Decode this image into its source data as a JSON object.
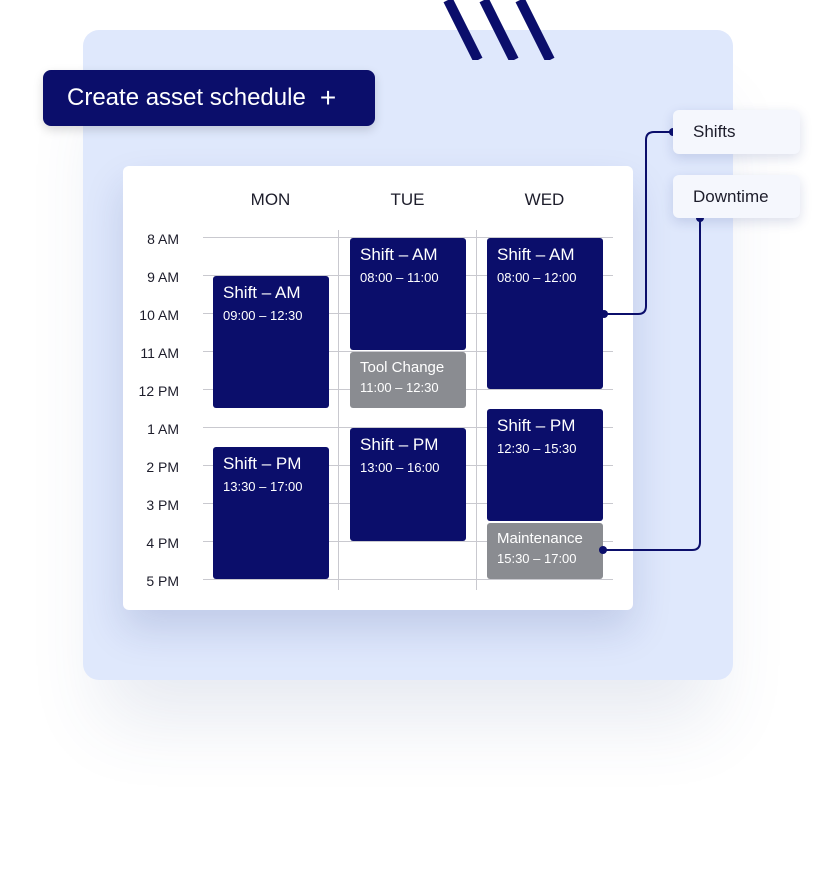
{
  "create_button": {
    "label": "Create asset schedule",
    "icon": "plus-icon"
  },
  "calendar": {
    "days": [
      "MON",
      "TUE",
      "WED"
    ],
    "times": [
      "8 AM",
      "9 AM",
      "10 AM",
      "11 AM",
      "12 PM",
      "1 AM",
      "2 PM",
      "3 PM",
      "4 PM",
      "5 PM"
    ],
    "events": {
      "mon_am": {
        "title": "Shift – AM",
        "range": "09:00 – 12:30",
        "type": "shift"
      },
      "mon_pm": {
        "title": "Shift – PM",
        "range": "13:30 – 17:00",
        "type": "shift"
      },
      "tue_am": {
        "title": "Shift – AM",
        "range": "08:00 – 11:00",
        "type": "shift"
      },
      "tue_tool": {
        "title": "Tool Change",
        "range": "11:00 – 12:30",
        "type": "downtime"
      },
      "tue_pm": {
        "title": "Shift – PM",
        "range": "13:00 – 16:00",
        "type": "shift"
      },
      "wed_am": {
        "title": "Shift – AM",
        "range": "08:00 – 12:00",
        "type": "shift"
      },
      "wed_pm": {
        "title": "Shift – PM",
        "range": "12:30 – 15:30",
        "type": "shift"
      },
      "wed_maint": {
        "title": "Maintenance",
        "range": "15:30 – 17:00",
        "type": "downtime"
      }
    }
  },
  "legend": {
    "shifts": "Shifts",
    "downtime": "Downtime"
  },
  "colors": {
    "shift": "#0b0e6b",
    "downtime": "#8a8c91",
    "panel": "#dfe8fc"
  }
}
